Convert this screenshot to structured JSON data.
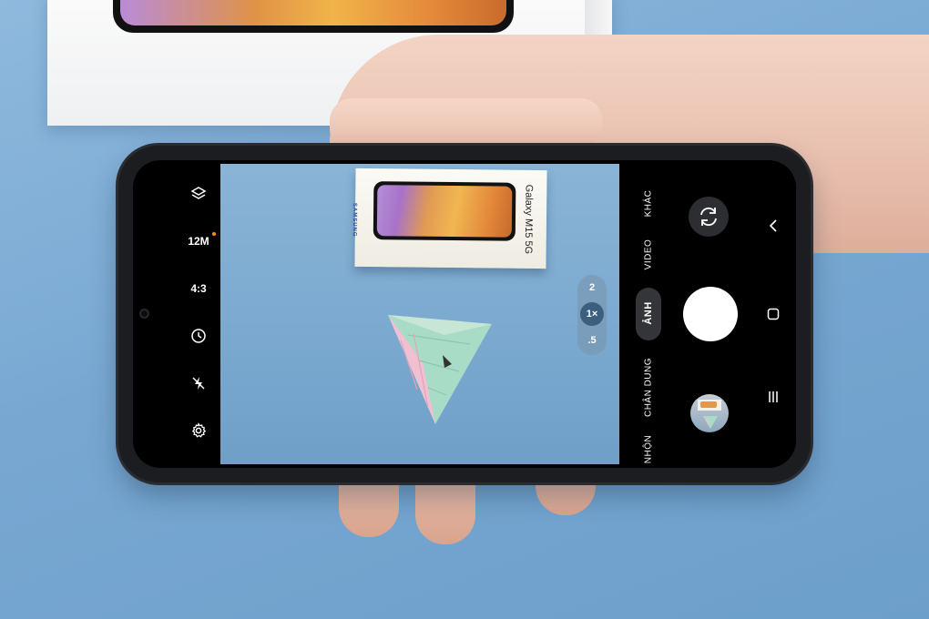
{
  "left_controls": {
    "resolution": "12M",
    "aspect_ratio": "4:3"
  },
  "zoom": {
    "options": [
      "2",
      "1×",
      ".5"
    ],
    "selected": "1×"
  },
  "modes": {
    "more": "KHÁC",
    "video": "VIDEO",
    "photo": "ẢNH",
    "portrait": "CHÂN DUNG",
    "night": "NHỘN"
  },
  "viewfinder": {
    "box_brand": "SAMSUNG",
    "box_model": "Galaxy M15 5G"
  },
  "colors": {
    "background": "#7aa9d2",
    "phone_body": "#1c1d20",
    "shutter": "#ffffff",
    "accent_dot": "#ff8a2a"
  }
}
